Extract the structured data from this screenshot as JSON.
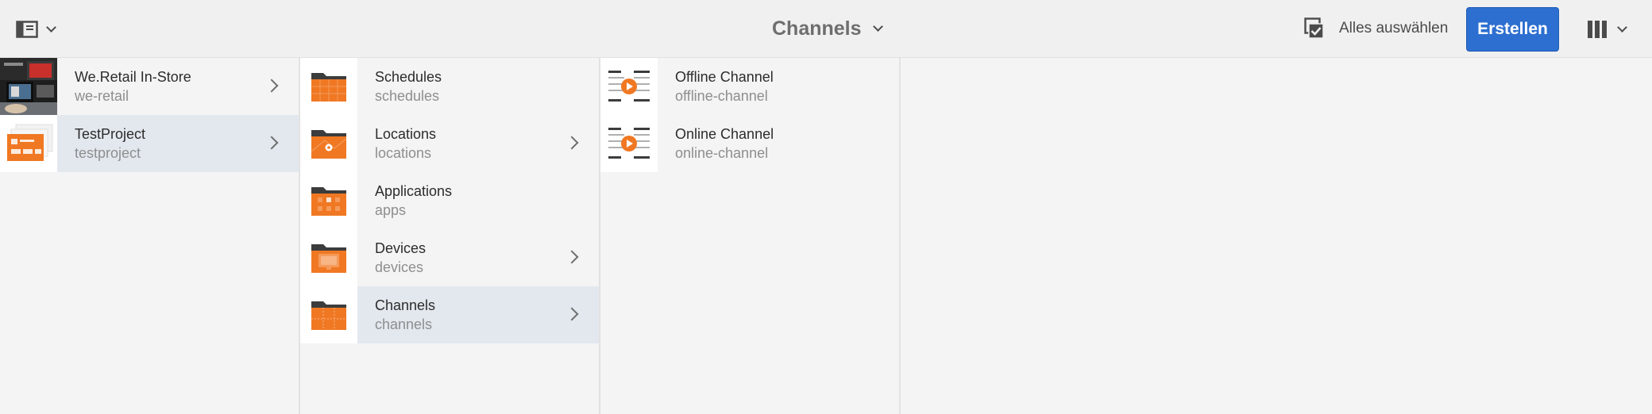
{
  "header": {
    "title": "Channels",
    "select_all_label": "Alles auswählen",
    "create_label": "Erstellen"
  },
  "columns": [
    {
      "items": [
        {
          "title": "We.Retail In-Store",
          "subtitle": "we-retail",
          "has_children": true,
          "active": false,
          "thumb": "we-retail-photo"
        },
        {
          "title": "TestProject",
          "subtitle": "testproject",
          "has_children": true,
          "active": true,
          "thumb": "project-card"
        }
      ]
    },
    {
      "items": [
        {
          "title": "Schedules",
          "subtitle": "schedules",
          "has_children": false,
          "active": false,
          "thumb": "folder-schedules-icon"
        },
        {
          "title": "Locations",
          "subtitle": "locations",
          "has_children": true,
          "active": false,
          "thumb": "folder-locations-icon"
        },
        {
          "title": "Applications",
          "subtitle": "apps",
          "has_children": false,
          "active": false,
          "thumb": "folder-applications-icon"
        },
        {
          "title": "Devices",
          "subtitle": "devices",
          "has_children": true,
          "active": false,
          "thumb": "folder-devices-icon"
        },
        {
          "title": "Channels",
          "subtitle": "channels",
          "has_children": true,
          "active": true,
          "thumb": "folder-channels-icon"
        }
      ]
    },
    {
      "items": [
        {
          "title": "Offline Channel",
          "subtitle": "offline-channel",
          "has_children": false,
          "active": false,
          "thumb": "channel-icon"
        },
        {
          "title": "Online Channel",
          "subtitle": "online-channel",
          "has_children": false,
          "active": false,
          "thumb": "channel-icon"
        }
      ]
    }
  ],
  "colors": {
    "accent": "#2d6fd0",
    "folder_orange": "#f07823",
    "folder_dark": "#3c3c3c",
    "active_row": "#e3e8ef"
  }
}
